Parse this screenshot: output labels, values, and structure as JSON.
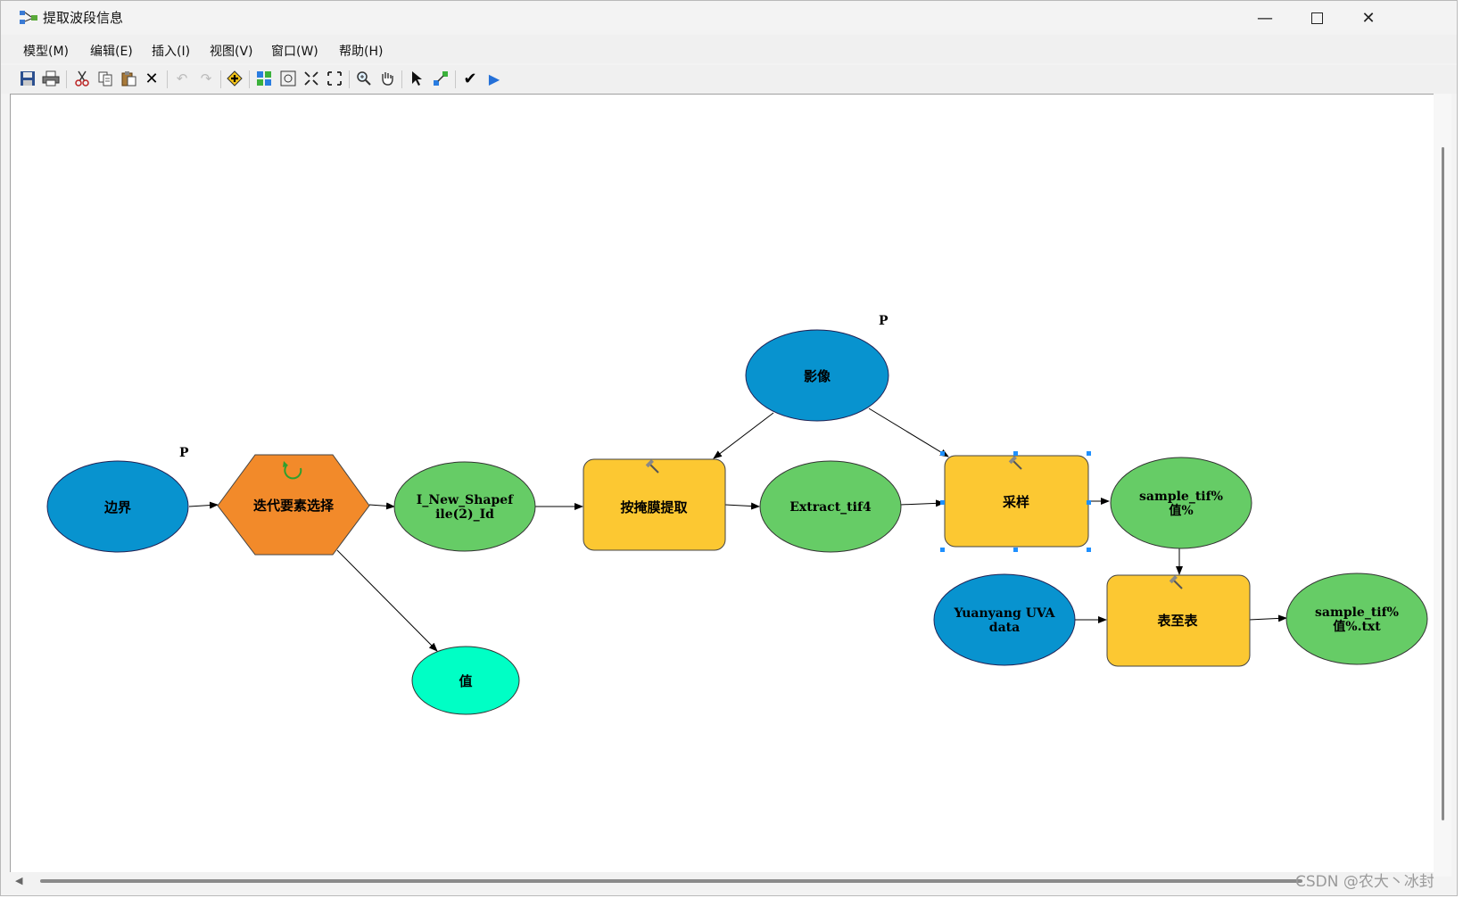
{
  "window": {
    "title": "提取波段信息"
  },
  "menu": [
    "模型(M)",
    "编辑(E)",
    "插入(I)",
    "视图(V)",
    "窗口(W)",
    "帮助(H)"
  ],
  "toolbar": [
    "save-icon",
    "print-icon",
    "cut-icon",
    "copy-icon",
    "paste-icon",
    "delete-icon",
    "undo-icon",
    "redo-icon",
    "add-data-icon",
    "auto-layout-icon",
    "full-extent-icon",
    "zoom-in-fixed-icon",
    "zoom-out-fixed-icon",
    "zoom-icon",
    "pan-icon",
    "select-icon",
    "connect-icon",
    "validate-icon",
    "run-icon"
  ],
  "nodes": {
    "boundary": "边界",
    "iterate": "迭代要素选择",
    "shapefile_line1": "I_New_Shapef",
    "shapefile_line2": "ile(2)_Id",
    "extract_mask": "按掩膜提取",
    "extract_tif": "Extract_tif4",
    "image": "影像",
    "sample": "采样",
    "sample_tif_line1": "sample_tif%",
    "sample_tif_line2": "值%",
    "value": "值",
    "yuanyang_line1": "Yuanyang UVA",
    "yuanyang_line2": "data",
    "table_to_table": "表至表",
    "sample_txt_line1": "sample_tif%",
    "sample_txt_line2": "值%.txt",
    "param_marker": "P"
  },
  "colors": {
    "input_blue": "#0893cf",
    "derived_green": "#66cc66",
    "tool_yellow": "#fcc832",
    "iterator_orange": "#f28a2a",
    "value_cyan": "#00ffc5"
  },
  "watermark": "CSDN @农大丶冰封"
}
